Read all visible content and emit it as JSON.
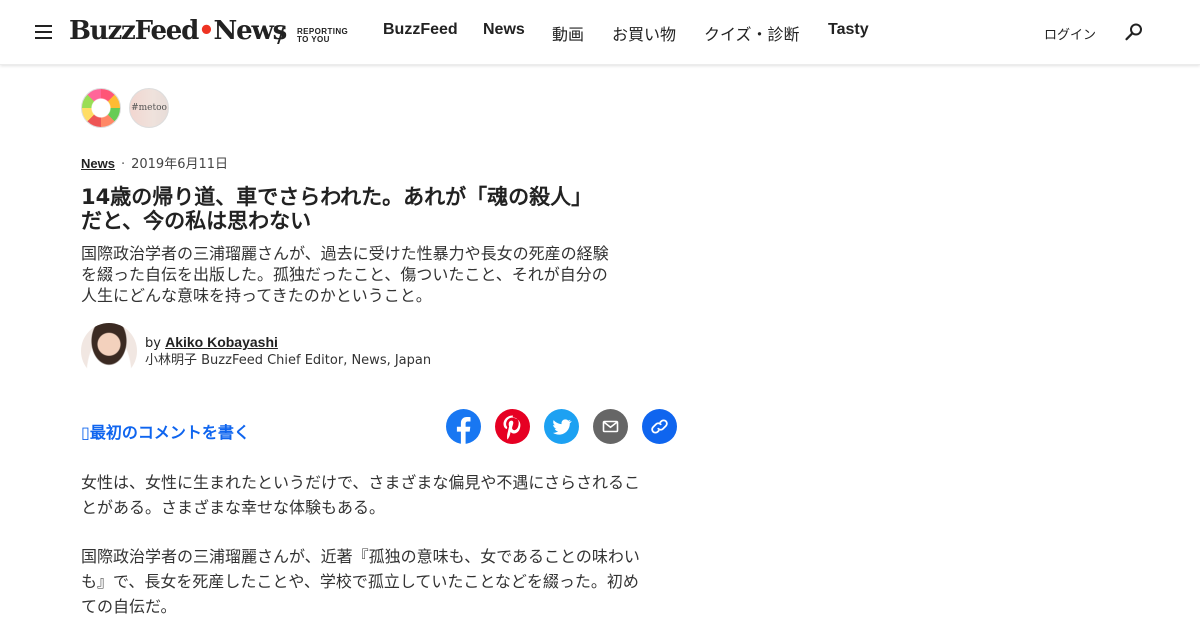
{
  "header": {
    "logo_main": "BuzzFeed",
    "logo_dot": "•",
    "logo_news": "News",
    "tagline_line1": "REPORTING",
    "tagline_line2": "TO YOU",
    "nav": [
      {
        "label": "BuzzFeed"
      },
      {
        "label": "News"
      },
      {
        "label": "動画"
      },
      {
        "label": "お買い物"
      },
      {
        "label": "クイズ・診断"
      },
      {
        "label": "Tasty"
      }
    ],
    "login_label": "ログイン",
    "search_icon": "search-icon",
    "menu_icon": "hamburger-menu-icon"
  },
  "topics": {
    "food_badge_icon": "food-bowl-badge",
    "metoo_label": "#metoo"
  },
  "article": {
    "category": "News",
    "separator": "·",
    "date": "2019年6月11日",
    "title_line1": "14歳の帰り道、車でさらわれた。あれが「魂の殺人」",
    "title_line2": "だと、今の私は思わない",
    "dek_line1": "国際政治学者の三浦瑠麗さんが、過去に受けた性暴力や長女の死産の経験",
    "dek_line2": "を綴った自伝を出版した。孤独だったこと、傷ついたこと、それが自分の",
    "dek_line3": "人生にどんな意味を持ってきたのかということ。",
    "byline_prefix": "by ",
    "author": "Akiko Kobayashi",
    "author_role": "小林明子 BuzzFeed Chief Editor, News, Japan",
    "comment_label": "最初のコメントを書く",
    "paragraph1_line1": "女性は、女性に生まれたというだけで、さまざまな偏見や不遇にさらされるこ",
    "paragraph1_line2": "とがある。さまざまな幸せな体験もある。",
    "paragraph2_line1": "国際政治学者の三浦瑠麗さんが、近著『孤独の意味も、女であることの味わい",
    "paragraph2_line2": "も』で、長女を死産したことや、学校で孤立していたことなどを綴った。初め",
    "paragraph2_line3": "ての自伝だ。"
  },
  "share": {
    "facebook_color": "#1877f2",
    "pinterest_color": "#e60023",
    "twitter_color": "#1da1f2",
    "mail_color": "#666666",
    "link_color": "#0f65ef"
  },
  "colors": {
    "accent_blue": "#0f65ef",
    "logo_dot_red": "#ee3322",
    "text": "#222222"
  }
}
